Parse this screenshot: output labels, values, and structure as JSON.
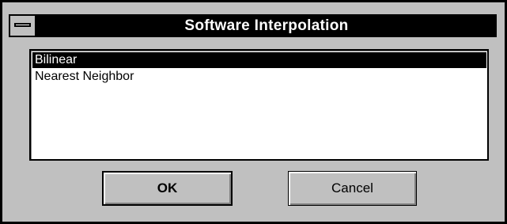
{
  "window": {
    "title": "Software Interpolation"
  },
  "list": {
    "items": [
      {
        "label": "Bilinear",
        "selected": true
      },
      {
        "label": "Nearest Neighbor",
        "selected": false
      }
    ]
  },
  "buttons": {
    "ok_label": "OK",
    "cancel_label": "Cancel"
  },
  "icons": {
    "system_menu": "system-menu-icon"
  },
  "colors": {
    "background": "#c0c0c0",
    "titlebar": "#000000",
    "selection": "#000000",
    "list_background": "#ffffff"
  }
}
